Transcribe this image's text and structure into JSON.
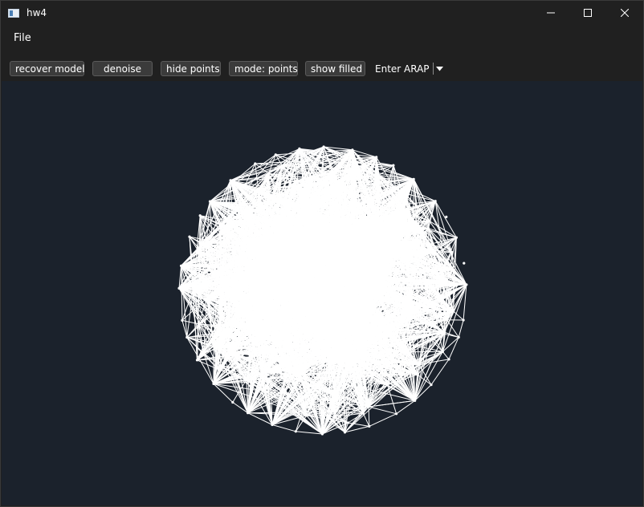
{
  "window": {
    "title": "hw4"
  },
  "menu": {
    "file_label": "File"
  },
  "toolbar": {
    "recover_model_label": "recover model",
    "denoise_label": "denoise",
    "hide_points_label": "hide points",
    "mode_label": "mode: points",
    "show_filled_label": "show filled",
    "arap_combo_value": "Enter ARAP"
  },
  "viewport": {
    "background_color": "#1b222c",
    "mesh_color": "#ffffff",
    "icons": [
      "minimize-icon",
      "maximize-icon",
      "close-icon",
      "chevron-down-icon"
    ]
  }
}
